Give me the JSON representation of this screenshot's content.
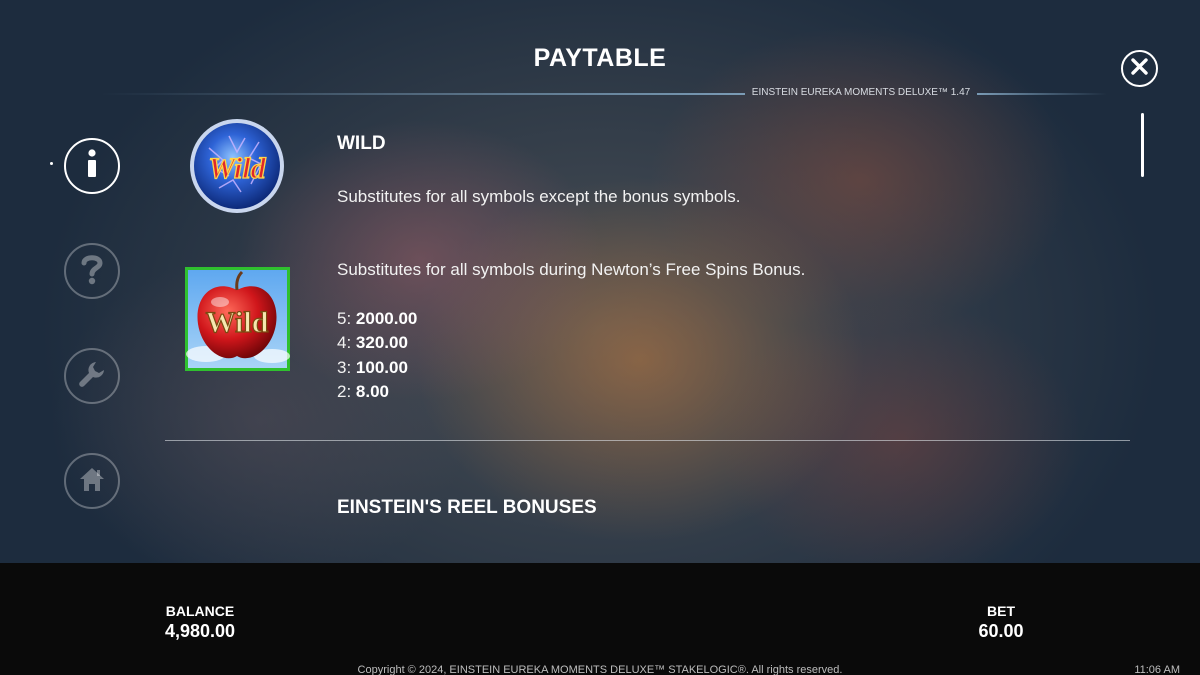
{
  "header": {
    "title": "PAYTABLE",
    "version": "EINSTEIN EUREKA MOMENTS DELUXE™ 1.47"
  },
  "close_button": {
    "icon": "close-icon",
    "label": "X"
  },
  "nav": [
    {
      "name": "info",
      "icon": "info-icon",
      "active": true
    },
    {
      "name": "help",
      "icon": "question-icon",
      "active": false
    },
    {
      "name": "settings",
      "icon": "wrench-icon",
      "active": false
    },
    {
      "name": "home",
      "icon": "home-icon",
      "active": false
    }
  ],
  "content": {
    "wild_heading": "WILD",
    "wild_text": "Substitutes for all symbols except the bonus symbols.",
    "wild_symbol_text": "Wild",
    "apple_symbol_text": "Wild",
    "apple_text": "Substitutes for all symbols during Newton’s Free Spins Bonus.",
    "payouts": [
      {
        "count": "5:",
        "value": "2000.00"
      },
      {
        "count": "4:",
        "value": "320.00"
      },
      {
        "count": "3:",
        "value": "100.00"
      },
      {
        "count": "2:",
        "value": "8.00"
      }
    ],
    "next_heading": "EINSTEIN'S REEL BONUSES"
  },
  "footer": {
    "balance_label": "BALANCE",
    "balance_value": "4,980.00",
    "bet_label": "BET",
    "bet_value": "60.00",
    "copyright": "Copyright © 2024, EINSTEIN EUREKA MOMENTS DELUXE™ STAKELOGIC®. All rights reserved.",
    "time": "11:06 AM"
  },
  "colors": {
    "footer_bg": "#0a0a0a",
    "apple_frame": "#2fc02f",
    "wild_text": "#e0262b",
    "wild_outline": "#ffd54a",
    "orb_blue": "#1f4fc8"
  }
}
